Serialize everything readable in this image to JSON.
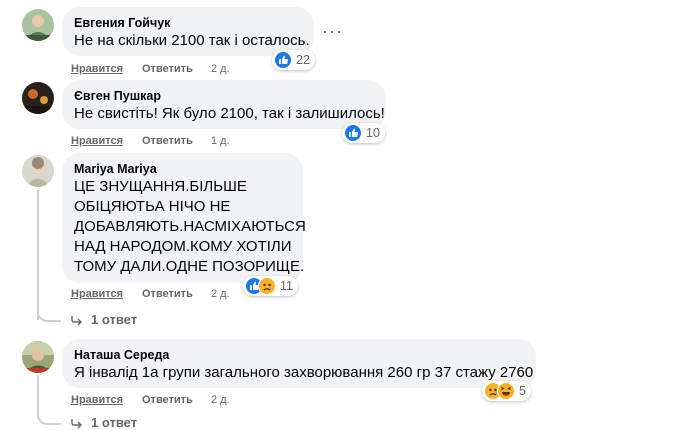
{
  "comments": [
    {
      "author": "Евгения Гойчук",
      "lines": [
        "Не на скільки 2100 так і осталось."
      ],
      "actions": {
        "like": "Нравится",
        "reply": "Ответить",
        "time": "2 д."
      },
      "reactions": {
        "types": [
          "like-icon"
        ],
        "count": "22"
      },
      "colors": {
        "avatar": "#5b7a57"
      }
    },
    {
      "author": "Євген Пушкар",
      "lines": [
        "Не свистіть! Як було 2100, так і залишилось!"
      ],
      "actions": {
        "like": "Нравится",
        "reply": "Ответить",
        "time": "1 д."
      },
      "reactions": {
        "types": [
          "like-icon"
        ],
        "count": "10"
      },
      "colors": {
        "avatar": "#3a2a22"
      }
    },
    {
      "author": "Mariya Mariya",
      "lines": [
        "ЦЕ ЗНУЩАННЯ.БІЛЬШЕ",
        "ОБІЦЯЮТЬА НІЧО НЕ",
        "ДОБАВЛЯЮТЬ.НАСМІХАЮТЬСЯ",
        "НАД НАРОДОМ.КОМУ ХОТІЛИ",
        "ТОМУ ДАЛИ.ОДНЕ ПОЗОРИЩЕ."
      ],
      "actions": {
        "like": "Нравится",
        "reply": "Ответить",
        "time": "2 д."
      },
      "reactions": {
        "types": [
          "like-icon",
          "sad-icon"
        ],
        "count": "11"
      },
      "replies_label": "1 ответ",
      "colors": {
        "avatar": "#b9b6a6"
      }
    },
    {
      "author": "Наташа Середа",
      "lines": [
        "Я інвалід 1а групи загального захворювання 260 гр 37 стажу 2760"
      ],
      "actions": {
        "like": "Нравится",
        "reply": "Ответить",
        "time": "2 д."
      },
      "reactions": {
        "types": [
          "sad-icon",
          "laugh-icon"
        ],
        "count": "5"
      },
      "replies_label": "1 ответ",
      "colors": {
        "avatar": "#6f7f4f"
      }
    }
  ],
  "more_icon": "more-dots-icon"
}
